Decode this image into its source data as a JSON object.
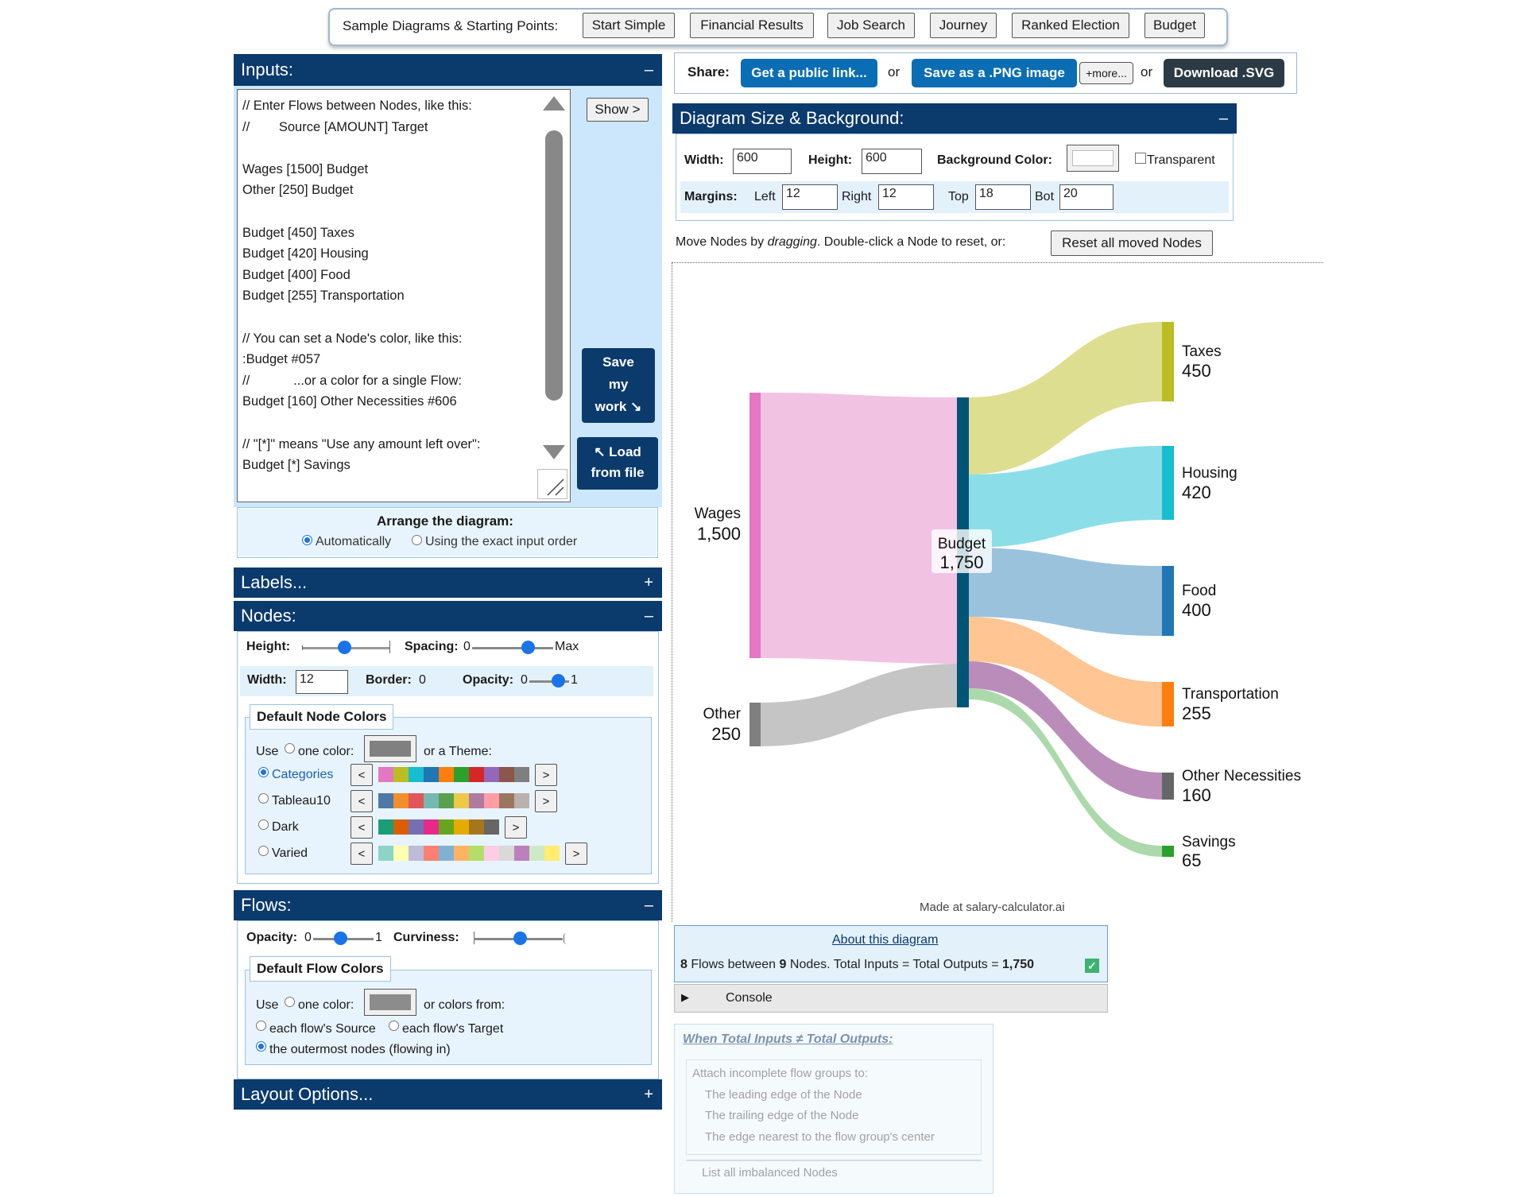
{
  "samples": {
    "label": "Sample Diagrams & Starting Points:",
    "buttons": [
      "Start Simple",
      "Financial Results",
      "Job Search",
      "Journey",
      "Ranked Election",
      "Budget"
    ]
  },
  "inputs": {
    "title": "Inputs:",
    "toggle": "–",
    "lines": [
      "// Enter Flows between Nodes, like this:",
      "//        Source [AMOUNT] Target",
      "",
      "Wages [1500] Budget",
      "Other [250] Budget",
      "",
      "Budget [450] Taxes",
      "Budget [420] Housing",
      "Budget [400] Food",
      "Budget [255] Transportation",
      "",
      "// You can set a Node's color, like this:",
      ":Budget #057",
      "//            ...or a color for a single Flow:",
      "Budget [160] Other Necessities #606",
      "",
      "// \"[*]\" means \"Use any amount left over\":",
      "Budget [*] Savings"
    ],
    "show_button": "Show >",
    "save_button": [
      "Save",
      "my",
      "work ↘"
    ],
    "load_button": [
      "↖ Load",
      "from file"
    ],
    "arrange_label": "Arrange the diagram:",
    "arrange_auto": "Automatically",
    "arrange_exact": "Using the exact input order"
  },
  "labels_panel": {
    "title": "Labels...",
    "toggle": "+"
  },
  "nodes_panel": {
    "title": "Nodes:",
    "toggle": "–",
    "height_label": "Height:",
    "spacing_label": "Spacing:",
    "spacing_min": "0",
    "spacing_max": "Max",
    "width_label": "Width:",
    "width_value": "12",
    "border_label": "Border:",
    "border_value": "0",
    "opacity_label": "Opacity:",
    "opacity_min": "0",
    "opacity_max": "1",
    "default_colors_title": "Default Node Colors",
    "use_label": "Use",
    "one_color": "one color:",
    "or_theme": "or a Theme:",
    "themes": [
      {
        "name": "Categories",
        "selected": true,
        "colors": [
          "#e377c2",
          "#bcbd22",
          "#17becf",
          "#1f77b4",
          "#ff7f0e",
          "#2ca02c",
          "#d62728",
          "#9467bd",
          "#8c564b",
          "#7f7f7f"
        ]
      },
      {
        "name": "Tableau10",
        "selected": false,
        "colors": [
          "#4e79a7",
          "#f28e2b",
          "#e15759",
          "#76b7b2",
          "#59a14f",
          "#edc948",
          "#b07aa1",
          "#ff9da7",
          "#9c755f",
          "#bab0ac"
        ]
      },
      {
        "name": "Dark",
        "selected": false,
        "colors": [
          "#1b9e77",
          "#d95f02",
          "#7570b3",
          "#e7298a",
          "#66a61e",
          "#e6ab02",
          "#a6761d",
          "#666666"
        ]
      },
      {
        "name": "Varied",
        "selected": false,
        "colors": [
          "#8dd3c7",
          "#ffffb3",
          "#bebada",
          "#fb8072",
          "#80b1d3",
          "#fdb462",
          "#b3de69",
          "#fccde5",
          "#d9d9d9",
          "#bc80bd",
          "#ccebc5",
          "#ffed6f"
        ]
      }
    ]
  },
  "flows_panel": {
    "title": "Flows:",
    "toggle": "–",
    "opacity_label": "Opacity:",
    "opacity_min": "0",
    "opacity_max": "1",
    "curviness_label": "Curviness:",
    "default_colors_title": "Default Flow Colors",
    "use_label": "Use",
    "one_color": "one color:",
    "or_colors": "or colors from:",
    "source": "each flow's Source",
    "target": "each flow's Target",
    "outermost": "the outermost nodes (flowing in)"
  },
  "layout_panel": {
    "title": "Layout Options...",
    "toggle": "+"
  },
  "share": {
    "label": "Share:",
    "public_link": "Get a public link...",
    "or1": "or",
    "png": "Save as a .PNG image",
    "more": "+more...",
    "or2": "or",
    "svg": "Download .SVG"
  },
  "size_panel": {
    "title": "Diagram Size & Background:",
    "toggle": "–",
    "width_label": "Width:",
    "width_value": "600",
    "height_label": "Height:",
    "height_value": "600",
    "bg_label": "Background Color:",
    "transparent": "Transparent",
    "margins_label": "Margins:",
    "left_label": "Left",
    "left_value": "12",
    "right_label": "Right",
    "right_value": "12",
    "top_label": "Top",
    "top_value": "18",
    "bot_label": "Bot",
    "bot_value": "20"
  },
  "move_nodes": {
    "text_a": "Move Nodes by ",
    "text_em": "dragging",
    "text_b": ". Double-click a Node to reset, or:",
    "reset_button": "Reset all moved Nodes"
  },
  "diagram": {
    "nodes": [
      {
        "name": "Wages",
        "value": "1,500",
        "color": "#e377c2"
      },
      {
        "name": "Other",
        "value": "250",
        "color": "#7f7f7f"
      },
      {
        "name": "Budget",
        "value": "1,750",
        "color": "#005577"
      },
      {
        "name": "Taxes",
        "value": "450",
        "color": "#bcbd22"
      },
      {
        "name": "Housing",
        "value": "420",
        "color": "#17becf"
      },
      {
        "name": "Food",
        "value": "400",
        "color": "#1f77b4"
      },
      {
        "name": "Transportation",
        "value": "255",
        "color": "#ff7f0e"
      },
      {
        "name": "Other Necessities",
        "value": "160",
        "color": "#666666"
      },
      {
        "name": "Savings",
        "value": "65",
        "color": "#2ca02c"
      }
    ],
    "credit": "Made at salary-calculator.ai"
  },
  "summary": {
    "about_link": "About this diagram",
    "flows_count": "8",
    "flows_text": "Flows between",
    "nodes_count": "9",
    "nodes_text": "Nodes. Total Inputs = Total Outputs = ",
    "total": "1,750",
    "check": "✓",
    "console": "Console"
  },
  "imbalance": {
    "title": "When Total Inputs ≠ Total Outputs:",
    "attach": "Attach incomplete flow groups to:",
    "options": [
      "The leading edge of the Node",
      "The trailing edge of the Node",
      "The edge nearest to the flow group's center"
    ],
    "list": "List all imbalanced Nodes"
  }
}
